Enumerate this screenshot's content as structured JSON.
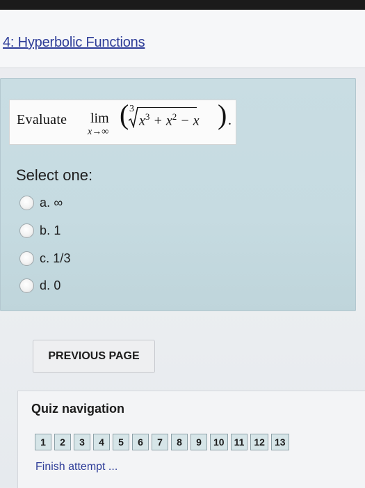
{
  "header": {
    "section_link": "4: Hyperbolic Functions"
  },
  "question": {
    "evaluate": "Evaluate",
    "lim": "lim",
    "lim_sub": "x→∞",
    "root_index": "3",
    "expr_x": "x",
    "expr_pow3": "3",
    "expr_plus": " + ",
    "expr_x2": "x",
    "expr_pow2": "2",
    "expr_minus": " − x",
    "paren_left": "(",
    "paren_right": ")",
    "end_dot": "."
  },
  "select_one": "Select one:",
  "options": [
    {
      "label": "a. ∞"
    },
    {
      "label": "b. 1"
    },
    {
      "label": "c. 1/3"
    },
    {
      "label": "d. 0"
    }
  ],
  "buttons": {
    "previous_page": "PREVIOUS PAGE"
  },
  "quiz_nav": {
    "title": "Quiz navigation",
    "questions": [
      "1",
      "2",
      "3",
      "4",
      "5",
      "6",
      "7",
      "8",
      "9",
      "10",
      "11",
      "12",
      "13"
    ],
    "finish": "Finish attempt ..."
  },
  "colors": {
    "link": "#2d3c98",
    "card_bg": "#c9dde3",
    "cell_bg": "#d6e5e8"
  }
}
